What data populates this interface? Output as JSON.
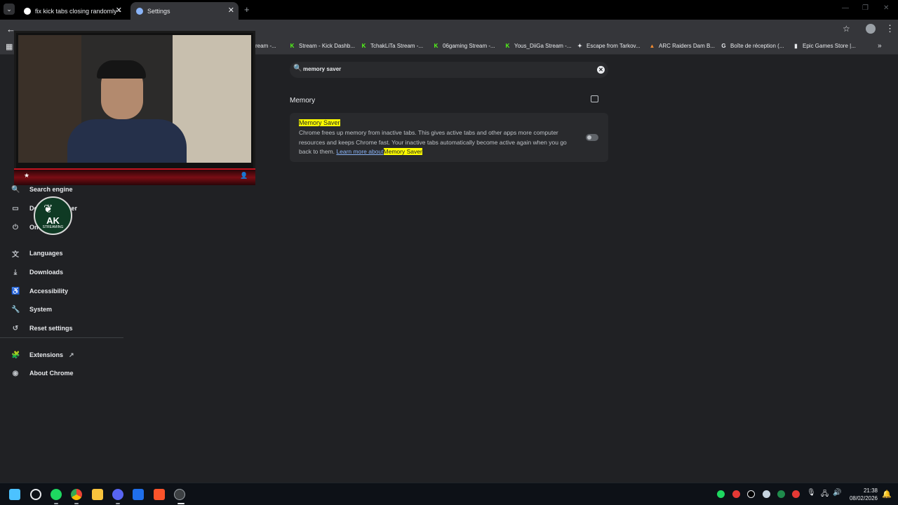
{
  "browser": {
    "tab_search_glyph": "⌄",
    "tabs": [
      {
        "title": "fix kick tabs closing randomly -",
        "close": "✕"
      },
      {
        "title": "Settings",
        "close": "✕"
      }
    ],
    "new_tab_glyph": "+",
    "window_controls": [
      "—",
      "❐",
      "✕"
    ],
    "back_glyph": "←",
    "star_glyph": "☆",
    "kebab_glyph": "⋮",
    "bookmarks_apps_glyph": "▦",
    "bookmarks": [
      {
        "label": "ream -...",
        "icon": "",
        "color": "#53fc18"
      },
      {
        "label": "Stream - Kick Dashb...",
        "icon": "K",
        "color": "#53fc18"
      },
      {
        "label": "TchakLiTa Stream -...",
        "icon": "K",
        "color": "#53fc18"
      },
      {
        "label": "06gaming Stream -...",
        "icon": "K",
        "color": "#53fc18"
      },
      {
        "label": "Yous_DiiGa Stream -...",
        "icon": "K",
        "color": "#53fc18"
      },
      {
        "label": "Escape from Tarkov...",
        "icon": "✦",
        "color": "#e8eaed"
      },
      {
        "label": "ARC Raiders Dam B...",
        "icon": "▲",
        "color": "#f28b30"
      },
      {
        "label": "Boîte de réception (...",
        "icon": "G",
        "color": "#e8eaed"
      },
      {
        "label": "Epic Games Store |...",
        "icon": "▮",
        "color": "#e8eaed"
      }
    ],
    "bookmarks_more_glyph": "»"
  },
  "settings": {
    "search": {
      "icon": "🔍",
      "value": "memory saver",
      "clear_glyph": "✕"
    },
    "section_title": "Memory",
    "card": {
      "name_highlight": "Memory Saver",
      "description": "Chrome frees up memory from inactive tabs. This gives active tabs and other apps more computer resources and keeps Chrome fast. Your inactive tabs automatically become active again when you go back to them.",
      "link_text": "Learn more about",
      "link_highlight": "Memory Saver",
      "toggle_on": false
    },
    "nav": [
      {
        "label": "Search engine",
        "icon": "🔍"
      },
      {
        "label": "Default browser",
        "icon": "▭"
      },
      {
        "label": "On startup",
        "icon": "⏻"
      },
      {
        "label": "Languages",
        "icon": "文"
      },
      {
        "label": "Downloads",
        "icon": "⤓"
      },
      {
        "label": "Accessibility",
        "icon": "♿"
      },
      {
        "label": "System",
        "icon": "🔧"
      },
      {
        "label": "Reset settings",
        "icon": "↺"
      },
      {
        "label": "Extensions",
        "icon": "🧩",
        "external": "↗"
      },
      {
        "label": "About Chrome",
        "icon": "◉"
      }
    ]
  },
  "overlay": {
    "star_glyph": "★",
    "user_glyph": "👤",
    "badge_top": "AK",
    "badge_bottom": "STREAMING",
    "badge_wings": "❦"
  },
  "taskbar": {
    "apps": [
      {
        "name": "start",
        "color": "#4cc2ff"
      },
      {
        "name": "search",
        "color": "#e8eaed"
      },
      {
        "name": "spotify",
        "color": "#1ed760"
      },
      {
        "name": "chrome",
        "color": "#fbbc04"
      },
      {
        "name": "explorer",
        "color": "#f8c33d"
      },
      {
        "name": "discord",
        "color": "#5865f2"
      },
      {
        "name": "photos",
        "color": "#1f6feb"
      },
      {
        "name": "brave",
        "color": "#fb542b"
      },
      {
        "name": "obs",
        "color": "#9aa0a6"
      }
    ],
    "tray": [
      {
        "name": "spotify-tray",
        "color": "#1ed760"
      },
      {
        "name": "mic-red",
        "color": "#e53935"
      },
      {
        "name": "tiktok",
        "color": "#e8eaed"
      },
      {
        "name": "steam",
        "color": "#c7d5e0"
      },
      {
        "name": "green-app",
        "color": "#1f8b4c"
      },
      {
        "name": "shield",
        "color": "#e8eaed"
      },
      {
        "name": "record",
        "color": "#e53935"
      }
    ],
    "mic_glyph": "🎙",
    "net_glyph": "🖧",
    "volume_glyph": "🔊",
    "time": "21:38",
    "date": "08/02/2026",
    "notif_glyph": "🔔"
  }
}
